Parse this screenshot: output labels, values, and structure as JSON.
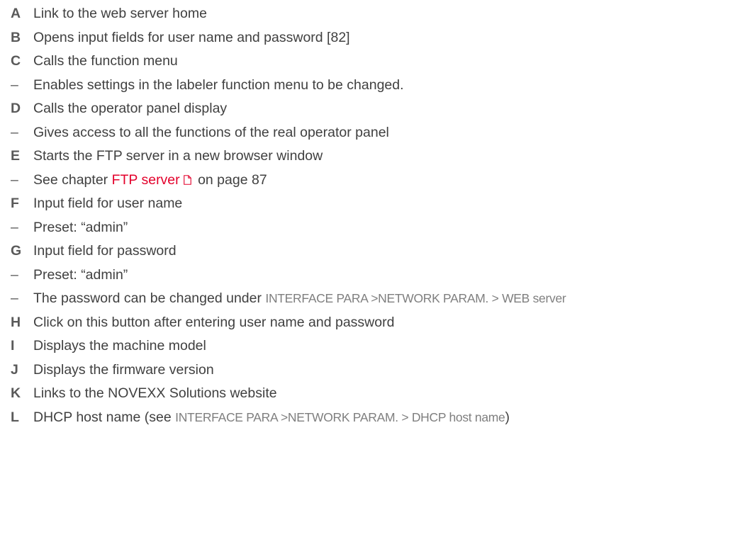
{
  "legend": {
    "items": [
      {
        "key": "A",
        "text": "Link to the web server home"
      },
      {
        "key": "B",
        "text": "Opens input fields for user name and password [82]"
      },
      {
        "key": "C",
        "text": "Calls the function menu"
      },
      {
        "key": "–",
        "text": "Enables settings in the labeler function menu to be changed."
      },
      {
        "key": "D",
        "text": "Calls the operator panel display"
      },
      {
        "key": "–",
        "text": "Gives access to all the functions of the real operator panel"
      },
      {
        "key": "E",
        "text": "Starts the FTP server in a new browser window"
      },
      {
        "key": "–",
        "text_before": "See chapter ",
        "link": "FTP server",
        "icon": "page-icon",
        "text_after": " on page 87"
      },
      {
        "key": "F",
        "text": "Input field for user name"
      },
      {
        "key": "–",
        "text": "Preset: “admin”"
      },
      {
        "key": "G",
        "text": "Input field for password"
      },
      {
        "key": "–",
        "text": "Preset: “admin”"
      },
      {
        "key": "–",
        "text_before": "The password can be changed under ",
        "menu_path": "INTERFACE PARA >NETWORK PARAM. > WEB server"
      },
      {
        "key": "H",
        "text": "Click on this button after entering user name and password"
      },
      {
        "key": "I",
        "text": "Displays the machine model"
      },
      {
        "key": "J",
        "text": "Displays the firmware version"
      },
      {
        "key": "K",
        "text": "Links to the NOVEXX Solutions website"
      },
      {
        "key": "L",
        "text_before": "DHCP host name (see ",
        "menu_path": "INTERFACE PARA >NETWORK PARAM. > DHCP host name",
        "text_after": ")"
      }
    ]
  },
  "colors": {
    "text": "#404040",
    "key": "#595959",
    "link": "#e3002b",
    "menu_path": "#7f7f7f"
  }
}
